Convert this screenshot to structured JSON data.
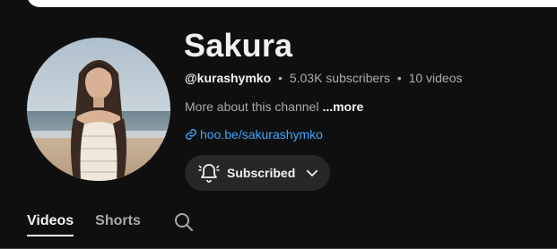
{
  "channel": {
    "name": "Sakura",
    "handle": "@kurashymko",
    "subscribers": "5.03K subscribers",
    "videos": "10 videos",
    "separator": "•",
    "about": "More about this channel",
    "more_label": "...more",
    "link": "hoo.be/sakurashymko"
  },
  "subscribe": {
    "label": "Subscribed",
    "bell_icon": "bell-icon",
    "dropdown_icon": "chevron-down-icon"
  },
  "tabs": [
    {
      "label": "Videos",
      "active": true
    },
    {
      "label": "Shorts",
      "active": false
    }
  ],
  "search_icon": "search-icon",
  "colors": {
    "background": "#0f0f0f",
    "link": "#3ea6ff",
    "button_bg": "#272727",
    "secondary_text": "#aaaaaa"
  }
}
